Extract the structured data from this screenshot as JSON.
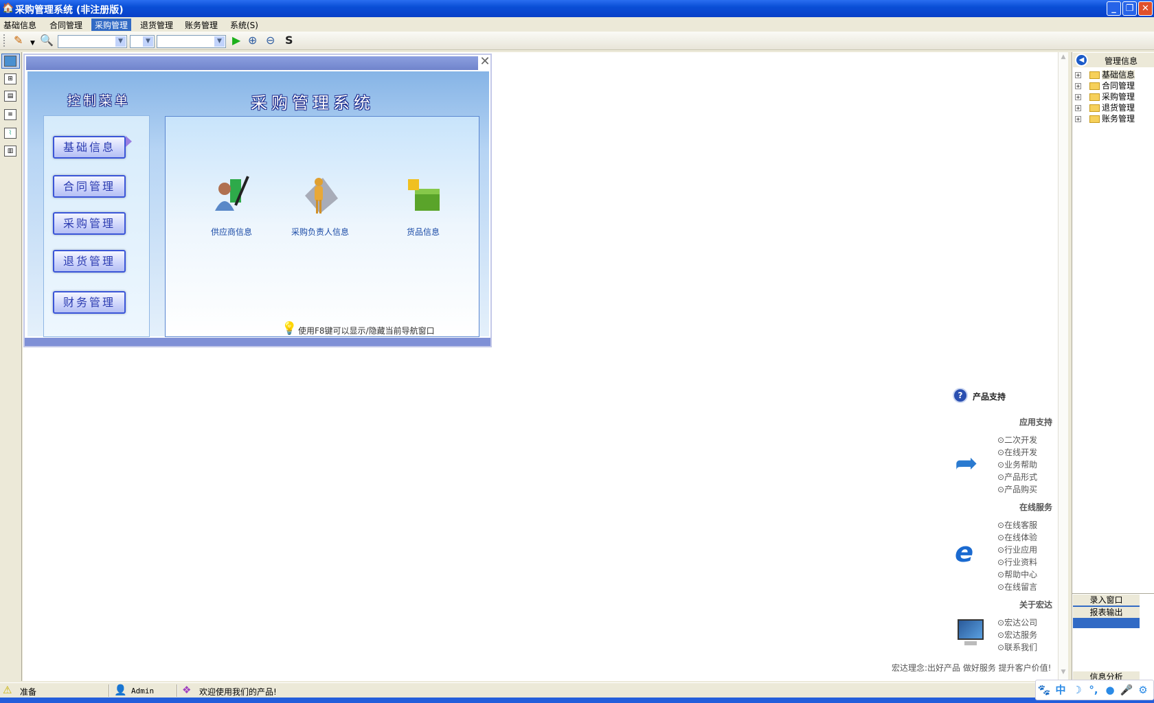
{
  "window": {
    "title": "采购管理系统 (非注册版)",
    "minimize": "_",
    "restore": "❐",
    "close": "✕"
  },
  "menu": [
    {
      "label": "基础信息"
    },
    {
      "label": "合同管理"
    },
    {
      "label": "采购管理",
      "active": true
    },
    {
      "label": "退货管理"
    },
    {
      "label": "账务管理"
    },
    {
      "label": "系统(S)"
    }
  ],
  "toolbar": {
    "combo1": "",
    "combo2": "",
    "combo3": ""
  },
  "nav": {
    "close": "✕",
    "menu_title": "控制菜单",
    "system_title": "采购管理系统",
    "buttons": [
      "基础信息",
      "合同管理",
      "采购管理",
      "退货管理",
      "财务管理"
    ],
    "items": [
      "供应商信息",
      "采购负责人信息",
      "货品信息"
    ],
    "hint": "使用F8键可以显示/隐藏当前导航窗口"
  },
  "support": {
    "title": "产品支持",
    "sections": [
      {
        "heading": "应用支持",
        "links": [
          "二次开发",
          "在线开发",
          "业务帮助",
          "产品形式",
          "产品购买"
        ]
      },
      {
        "heading": "在线服务",
        "links": [
          "在线客服",
          "在线体验",
          "行业应用",
          "行业资料",
          "帮助中心",
          "在线留言"
        ]
      },
      {
        "heading": "关于宏达",
        "links": [
          "宏达公司",
          "宏达服务",
          "联系我们"
        ]
      }
    ],
    "tagline": "宏达理念:出好产品 做好服务 提升客户价值!"
  },
  "right_panel": {
    "title": "管理信息",
    "tree": [
      "基础信息",
      "合同管理",
      "采购管理",
      "退货管理",
      "账务管理"
    ],
    "tabs": [
      "录入窗口",
      "报表输出"
    ],
    "bottom_tab": "信息分析"
  },
  "status": {
    "state": "准备",
    "user": "Admin",
    "message": "欢迎使用我们的产品!"
  },
  "ime": {
    "lang": "中"
  },
  "colors": {
    "titlebar": "#0a4fd6",
    "accent": "#316ac5",
    "nav_button_border": "#3a55d8"
  }
}
